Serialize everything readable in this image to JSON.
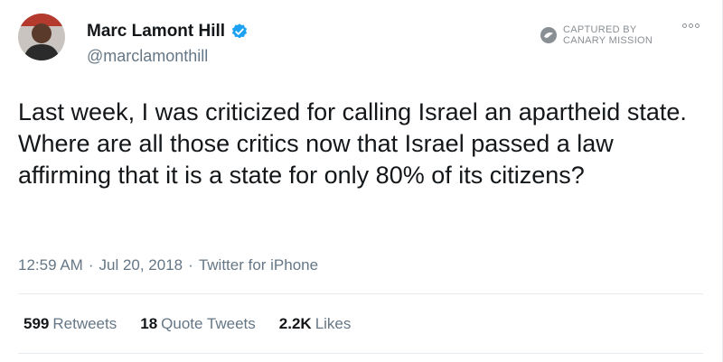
{
  "author": {
    "name": "Marc Lamont Hill",
    "handle": "@marclamonthill",
    "verified": true
  },
  "watermark": {
    "line1": "CAPTURED BY",
    "line2": "CANARY MISSION"
  },
  "tweet": {
    "text": "Last week, I was criticized for calling Israel an apartheid state. Where are all those critics now that Israel passed a law affirming that it is a state for only 80% of its citizens?"
  },
  "meta": {
    "time": "12:59 AM",
    "sep1": "·",
    "date": "Jul 20, 2018",
    "sep2": "·",
    "source": "Twitter for iPhone"
  },
  "stats": {
    "retweets_count": "599",
    "retweets_label": "Retweets",
    "quotes_count": "18",
    "quotes_label": "Quote Tweets",
    "likes_count": "2.2K",
    "likes_label": "Likes"
  },
  "colors": {
    "verified_blue": "#1da1f2",
    "secondary_text": "#657786",
    "primary_text": "#14171a"
  }
}
